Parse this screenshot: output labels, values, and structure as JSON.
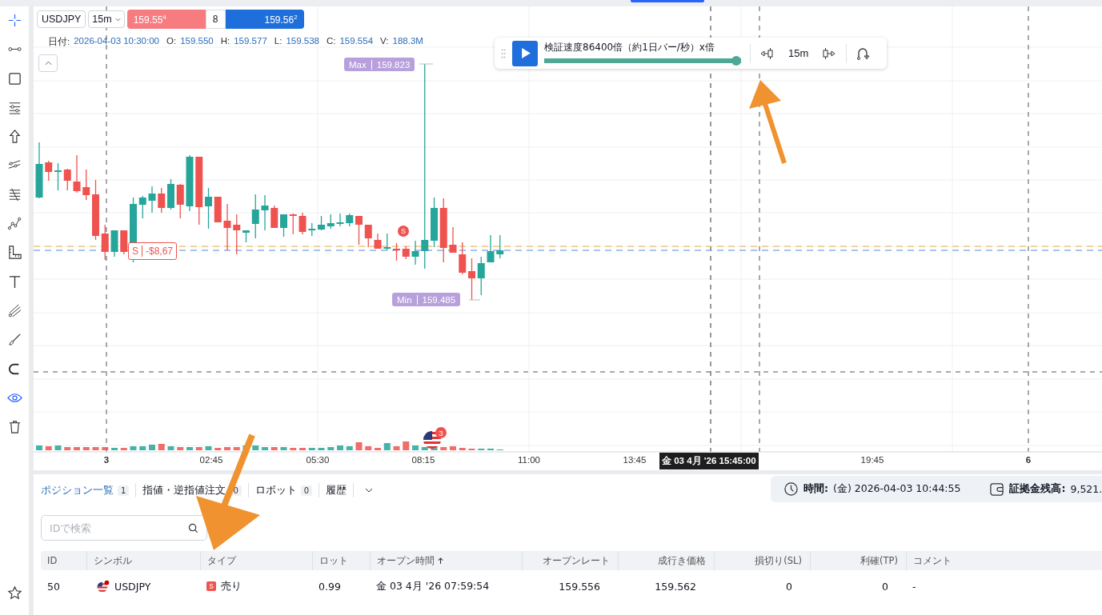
{
  "toolbar": {
    "symbol": "USDJPY",
    "interval": "15m",
    "sell_price": "159.55$^{4}$",
    "spread": "8",
    "buy_price": "159.56$^{2}$"
  },
  "ohlc": {
    "date_label": "日付:",
    "date": "2026-04-03 10:30:00",
    "items": [
      {
        "label": "O:",
        "value": "159.550"
      },
      {
        "label": "H:",
        "value": "159.577"
      },
      {
        "label": "L:",
        "value": "159.538"
      },
      {
        "label": "C:",
        "value": "159.554"
      },
      {
        "label": "V:",
        "value": "188.3M"
      }
    ]
  },
  "replay": {
    "speed_label": "検証速度86400倍（約1日バー/秒）x倍",
    "level": 1,
    "interval": "15m"
  },
  "drawings_visible": true,
  "chart": {
    "max_label": "Max",
    "max_value": "159.823",
    "min_label": "Min",
    "min_value": "159.485",
    "trade_marker": "S",
    "position_side": "S",
    "position_pnl": "-$8,67",
    "event_count": "3",
    "time_axis": [
      {
        "label": "3",
        "bold": true
      },
      {
        "label": "02:45",
        "bold": false
      },
      {
        "label": "05:30",
        "bold": false
      },
      {
        "label": "08:15",
        "bold": false
      },
      {
        "label": "11:00",
        "bold": false
      },
      {
        "label": "13:45",
        "bold": false
      },
      {
        "label": "19:45",
        "bold": false
      },
      {
        "label": "6",
        "bold": true
      }
    ],
    "crosshair_time": "金 03 4月 '26 15:45:00"
  },
  "tabs": [
    {
      "label": "ポジション一覧",
      "count": "1",
      "selected": true
    },
    {
      "label": "指値・逆指値注文",
      "count": "0",
      "selected": false
    },
    {
      "label": "ロボット",
      "count": "0",
      "selected": false
    },
    {
      "label": "履歴",
      "selected": false
    }
  ],
  "status": {
    "time_label": "時間:",
    "time": "(金) 2026-04-03 10:44:55",
    "balance_label": "証拠金残高:",
    "balance": "9,521."
  },
  "search": {
    "placeholder": "IDで検索"
  },
  "table": {
    "columns": [
      {
        "label": "ID",
        "sorted": false
      },
      {
        "label": "シンボル",
        "sorted": false
      },
      {
        "label": "タイプ",
        "sorted": false
      },
      {
        "label": "ロット",
        "sorted": false
      },
      {
        "label": "オープン時間",
        "sorted": true
      },
      {
        "label": "オープンレート",
        "sorted": false
      },
      {
        "label": "成行き価格",
        "sorted": false
      },
      {
        "label": "損切り(SL)",
        "sorted": false
      },
      {
        "label": "利確(TP)",
        "sorted": false
      },
      {
        "label": "コメント",
        "sorted": false
      }
    ],
    "rows": [
      {
        "id": "50",
        "symbol": "USDJPY",
        "type_badge": "S",
        "type": "売り",
        "lot": "0.99",
        "open_time": "金 03 4月 '26 07:59:54",
        "open_rate": "159.556",
        "market_price": "159.562",
        "sl": "0",
        "tp": "0",
        "comment": "-"
      }
    ]
  }
}
